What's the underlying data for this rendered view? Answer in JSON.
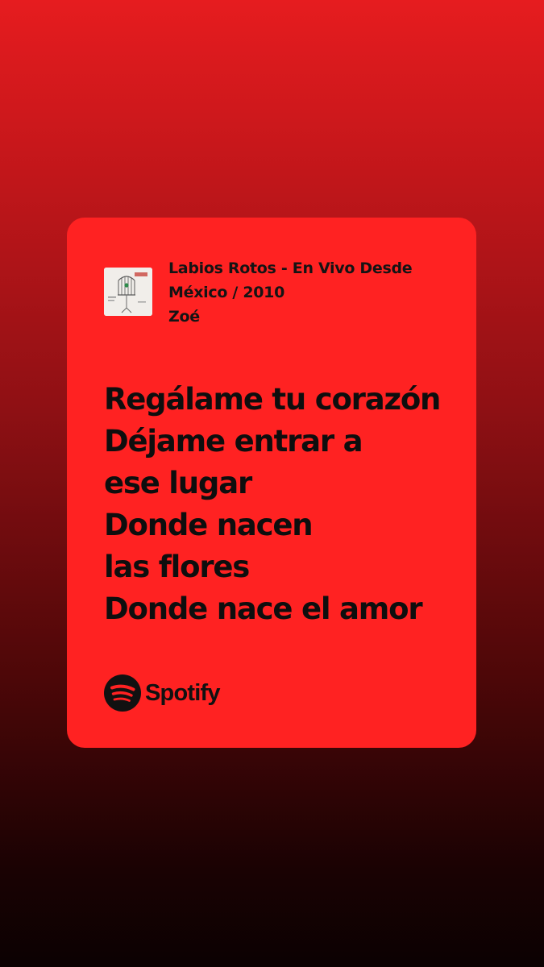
{
  "track": {
    "title": "Labios Rotos - En Vivo Desde México / 2010",
    "artist": "Zoé",
    "album_art_icon": "birdcage-album-art"
  },
  "lyrics": {
    "lines": [
      "Regálame tu corazón",
      "Déjame entrar a",
      "ese lugar",
      "Donde nacen",
      "las flores",
      "Donde nace el amor"
    ]
  },
  "brand": {
    "name": "Spotify",
    "icon": "spotify-logo-icon"
  },
  "colors": {
    "card": "#ff2222",
    "gradient_top": "#e61c1f",
    "gradient_bottom": "#0b0102",
    "text": "#111111"
  }
}
